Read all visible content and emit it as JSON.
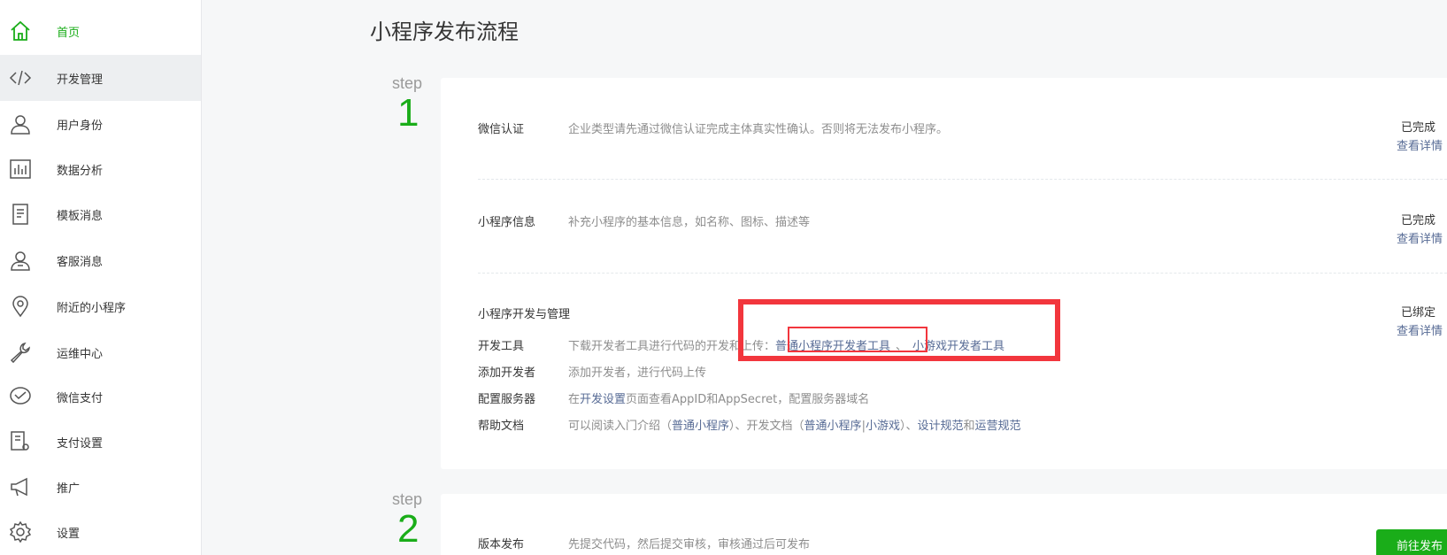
{
  "sidebar": {
    "items": [
      {
        "label": "首页",
        "icon": "home-icon"
      },
      {
        "label": "开发管理",
        "icon": "code-icon"
      },
      {
        "label": "用户身份",
        "icon": "user-icon"
      },
      {
        "label": "数据分析",
        "icon": "chart-icon"
      },
      {
        "label": "模板消息",
        "icon": "document-icon"
      },
      {
        "label": "客服消息",
        "icon": "support-user-icon"
      },
      {
        "label": "附近的小程序",
        "icon": "location-pin-icon"
      },
      {
        "label": "运维中心",
        "icon": "wrench-icon"
      },
      {
        "label": "微信支付",
        "icon": "wechat-pay-icon"
      },
      {
        "label": "支付设置",
        "icon": "payment-settings-icon"
      },
      {
        "label": "推广",
        "icon": "megaphone-icon"
      },
      {
        "label": "设置",
        "icon": "gear-icon"
      }
    ]
  },
  "main": {
    "title": "小程序发布流程",
    "step1": {
      "step_label": "step",
      "step_number": "1",
      "wechat_auth": {
        "title": "微信认证",
        "desc": "企业类型请先通过微信认证完成主体真实性确认。否则将无法发布小程序。",
        "status": "已完成",
        "detail": "查看详情"
      },
      "app_info": {
        "title": "小程序信息",
        "desc": "补充小程序的基本信息，如名称、图标、描述等",
        "status": "已完成",
        "detail": "查看详情"
      },
      "dev_manage": {
        "title": "小程序开发与管理",
        "status": "已绑定",
        "detail": "查看详情",
        "dev_tools": {
          "label": "开发工具",
          "desc_prefix": "下载开发者工具进行代码的开发和上传：",
          "link_normal": "普通小程序开发者工具",
          "sep": "、",
          "link_game": "小游戏开发者工具"
        },
        "add_dev": {
          "label": "添加开发者",
          "desc": "添加开发者，进行代码上传"
        },
        "server": {
          "label": "配置服务器",
          "prefix": "在",
          "link": "开发设置",
          "suffix": "页面查看AppID和AppSecret，配置服务器域名"
        },
        "help": {
          "label": "帮助文档",
          "t1": "可以阅读入门介绍（",
          "l1": "普通小程序",
          "t2": "）、开发文档（",
          "l2": "普通小程序",
          "t3": "|",
          "l3": "小游戏",
          "t4": "）、",
          "l4": "设计规范",
          "t5": "和",
          "l5": "运营规范"
        }
      }
    },
    "step2": {
      "step_label": "step",
      "step_number": "2",
      "release": {
        "title": "版本发布",
        "desc": "先提交代码，然后提交审核，审核通过后可发布",
        "button": "前往发布"
      }
    }
  },
  "colors": {
    "brand_green": "#1aad19",
    "link_blue": "#576b95",
    "highlight_red": "#f2363d"
  }
}
